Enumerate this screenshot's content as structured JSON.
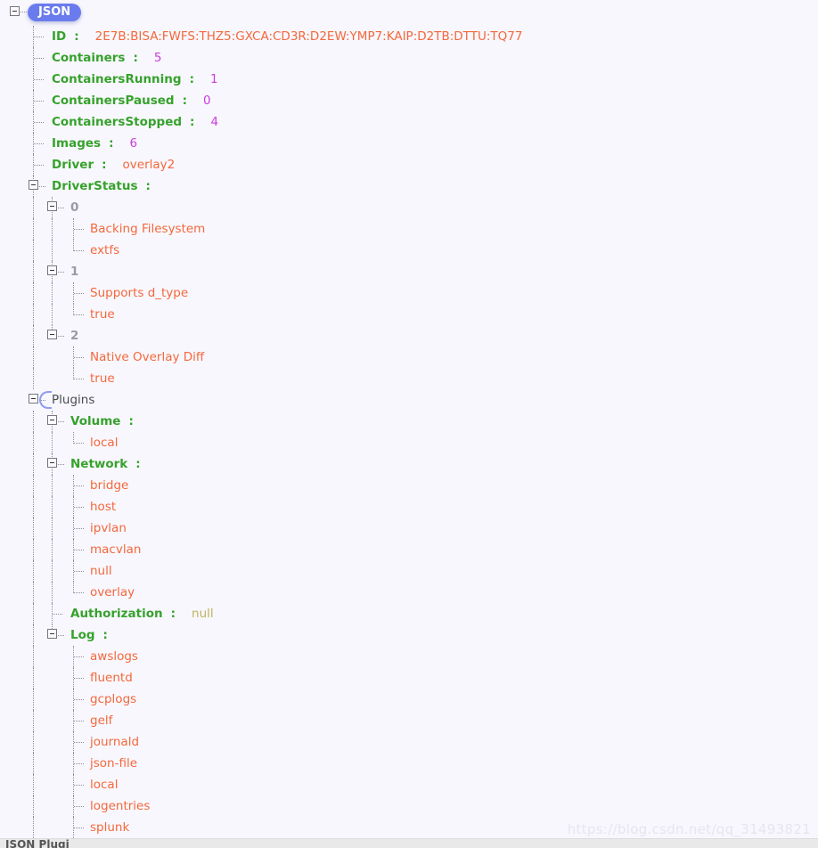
{
  "root": {
    "badge_label": "JSON",
    "badge_color": "#6a7ced"
  },
  "colors": {
    "background": "#f8f7fd",
    "key": "#36a22c",
    "string": "#f4683c",
    "number": "#cc3bdd",
    "null": "#bdb25f",
    "index": "#9a9aa4",
    "tree_line": "#8d8d9a"
  },
  "tree": {
    "id": {
      "key": "ID",
      "sep": ":",
      "value": "2E7B:BISA:FWFS:THZ5:GXCA:CD3R:D2EW:YMP7:KAIP:D2TB:DTTU:TQ77"
    },
    "containers": {
      "key": "Containers",
      "sep": ":",
      "value": "5"
    },
    "containers_running": {
      "key": "ContainersRunning",
      "sep": ":",
      "value": "1"
    },
    "containers_paused": {
      "key": "ContainersPaused",
      "sep": ":",
      "value": "0"
    },
    "containers_stopped": {
      "key": "ContainersStopped",
      "sep": ":",
      "value": "4"
    },
    "images": {
      "key": "Images",
      "sep": ":",
      "value": "6"
    },
    "driver": {
      "key": "Driver",
      "sep": ":",
      "value": "overlay2"
    },
    "driver_status": {
      "key": "DriverStatus",
      "sep": ":",
      "items": [
        {
          "index": "0",
          "values": [
            "Backing Filesystem",
            "extfs"
          ]
        },
        {
          "index": "1",
          "values": [
            "Supports d_type",
            "true"
          ]
        },
        {
          "index": "2",
          "values": [
            "Native Overlay Diff",
            "true"
          ]
        }
      ]
    },
    "plugins": {
      "label": "Plugins",
      "volume": {
        "key": "Volume",
        "sep": ":",
        "values": [
          "local"
        ]
      },
      "network": {
        "key": "Network",
        "sep": ":",
        "values": [
          "bridge",
          "host",
          "ipvlan",
          "macvlan",
          "null",
          "overlay"
        ]
      },
      "authorization": {
        "key": "Authorization",
        "sep": ":",
        "value": "null"
      },
      "log": {
        "key": "Log",
        "sep": ":",
        "values": [
          "awslogs",
          "fluentd",
          "gcplogs",
          "gelf",
          "journald",
          "json-file",
          "local",
          "logentries",
          "splunk"
        ]
      }
    }
  },
  "footer": {
    "text": "JSON Plugi"
  },
  "watermark": {
    "text": "https://blog.csdn.net/qq_31493821"
  }
}
